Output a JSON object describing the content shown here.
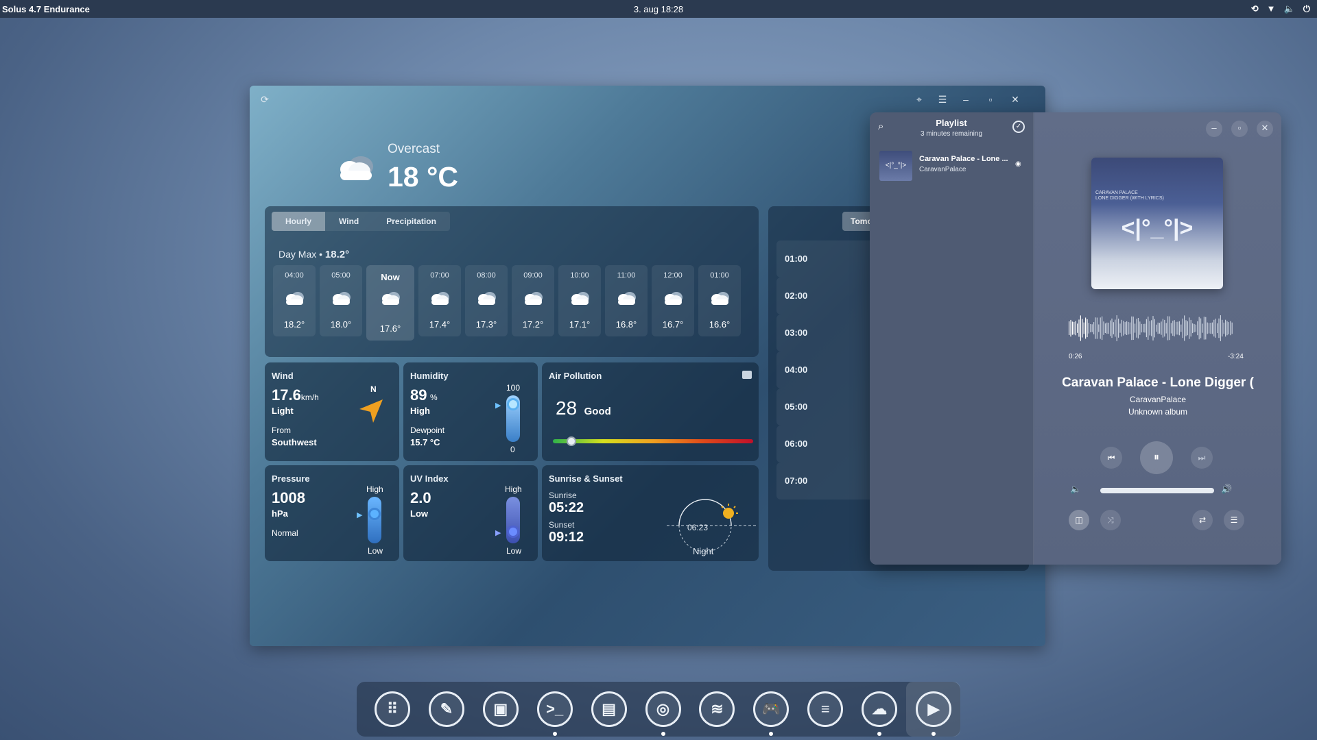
{
  "topbar": {
    "os_name": "Solus 4.7 Endurance",
    "datetime": "3. aug  18:28"
  },
  "weather": {
    "condition": "Overcast",
    "temperature": "18 °C",
    "tabs": [
      {
        "label": "Hourly"
      },
      {
        "label": "Wind"
      },
      {
        "label": "Precipitation"
      }
    ],
    "day_max_label": "Day Max •",
    "day_max_value": "18.2°",
    "hours": [
      {
        "time": "04:00",
        "temp": "18.2°"
      },
      {
        "time": "05:00",
        "temp": "18.0°"
      },
      {
        "time": "Now",
        "temp": "17.6°"
      },
      {
        "time": "07:00",
        "temp": "17.4°"
      },
      {
        "time": "08:00",
        "temp": "17.3°"
      },
      {
        "time": "09:00",
        "temp": "17.2°"
      },
      {
        "time": "10:00",
        "temp": "17.1°"
      },
      {
        "time": "11:00",
        "temp": "16.8°"
      },
      {
        "time": "12:00",
        "temp": "16.7°"
      },
      {
        "time": "01:00",
        "temp": "16.6°"
      }
    ],
    "wind": {
      "title": "Wind",
      "speed": "17.6",
      "unit": "km/h",
      "desc": "Light",
      "from_label": "From",
      "from": "Southwest",
      "compass_n": "N"
    },
    "humidity": {
      "title": "Humidity",
      "value": "89",
      "unit": "%",
      "desc": "High",
      "dewpoint_label": "Dewpoint",
      "dewpoint": "15.7 °C",
      "max": "100",
      "min": "0",
      "level": 0.89
    },
    "air": {
      "title": "Air Pollution",
      "value": "28",
      "desc": "Good",
      "level": 0.08
    },
    "pressure": {
      "title": "Pressure",
      "value": "1008",
      "unit": "hPa",
      "desc": "Normal",
      "high": "High",
      "low": "Low"
    },
    "uv": {
      "title": "UV Index",
      "value": "2.0",
      "desc": "Low",
      "high": "High",
      "low": "Low"
    },
    "sun": {
      "title": "Sunrise & Sunset",
      "sunrise_label": "Sunrise",
      "sunrise": "05:22",
      "sunset_label": "Sunset",
      "sunset": "09:12",
      "time": "06:23",
      "phase": "Night"
    },
    "tomorrow_tab": "Tomo",
    "hour_list": [
      "01:00",
      "02:00",
      "03:00",
      "04:00",
      "05:00",
      "06:00",
      "07:00"
    ]
  },
  "music": {
    "playlist_title": "Playlist",
    "remaining": "3 minutes remaining",
    "track_short": "Caravan Palace - Lone ...",
    "artist": "CaravanPalace",
    "cover_line1": "CARAVAN PALACE",
    "cover_line2": "LONE DIGGER (WITH LYRICS)",
    "cover_art": "<|°_°|>",
    "elapsed": "0:26",
    "remaining_time": "-3:24",
    "track_title": "Caravan Palace - Lone Digger (",
    "artist_main": "CaravanPalace",
    "album": "Unknown album"
  },
  "dock": [
    "app-grid-icon",
    "settings-wand-icon",
    "software-center-icon",
    "terminal-icon",
    "files-icon",
    "chrome-icon",
    "spotify-icon",
    "games-icon",
    "layers-icon",
    "cloud-settings-icon",
    "music-player-icon"
  ]
}
